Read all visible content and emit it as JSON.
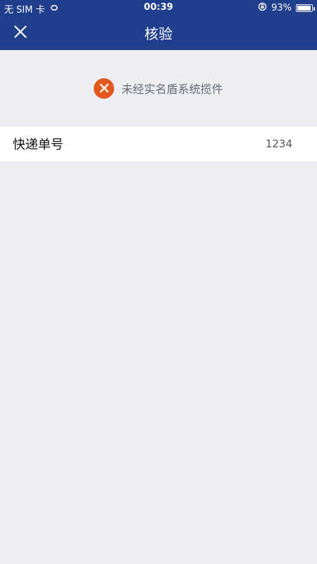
{
  "status_bar": {
    "carrier": "无 SIM 卡",
    "time": "00:39",
    "battery_percent_label": "93%",
    "battery_level": 0.93
  },
  "nav": {
    "title": "核验",
    "close_icon": "close-icon"
  },
  "result": {
    "icon": "error-x-icon",
    "message": "未经实名盾系统揽件",
    "color": "#e2571e"
  },
  "details": {
    "tracking_label": "快递单号",
    "tracking_value": "1234"
  },
  "colors": {
    "header": "#1f3f8c",
    "background": "#eceef3"
  }
}
